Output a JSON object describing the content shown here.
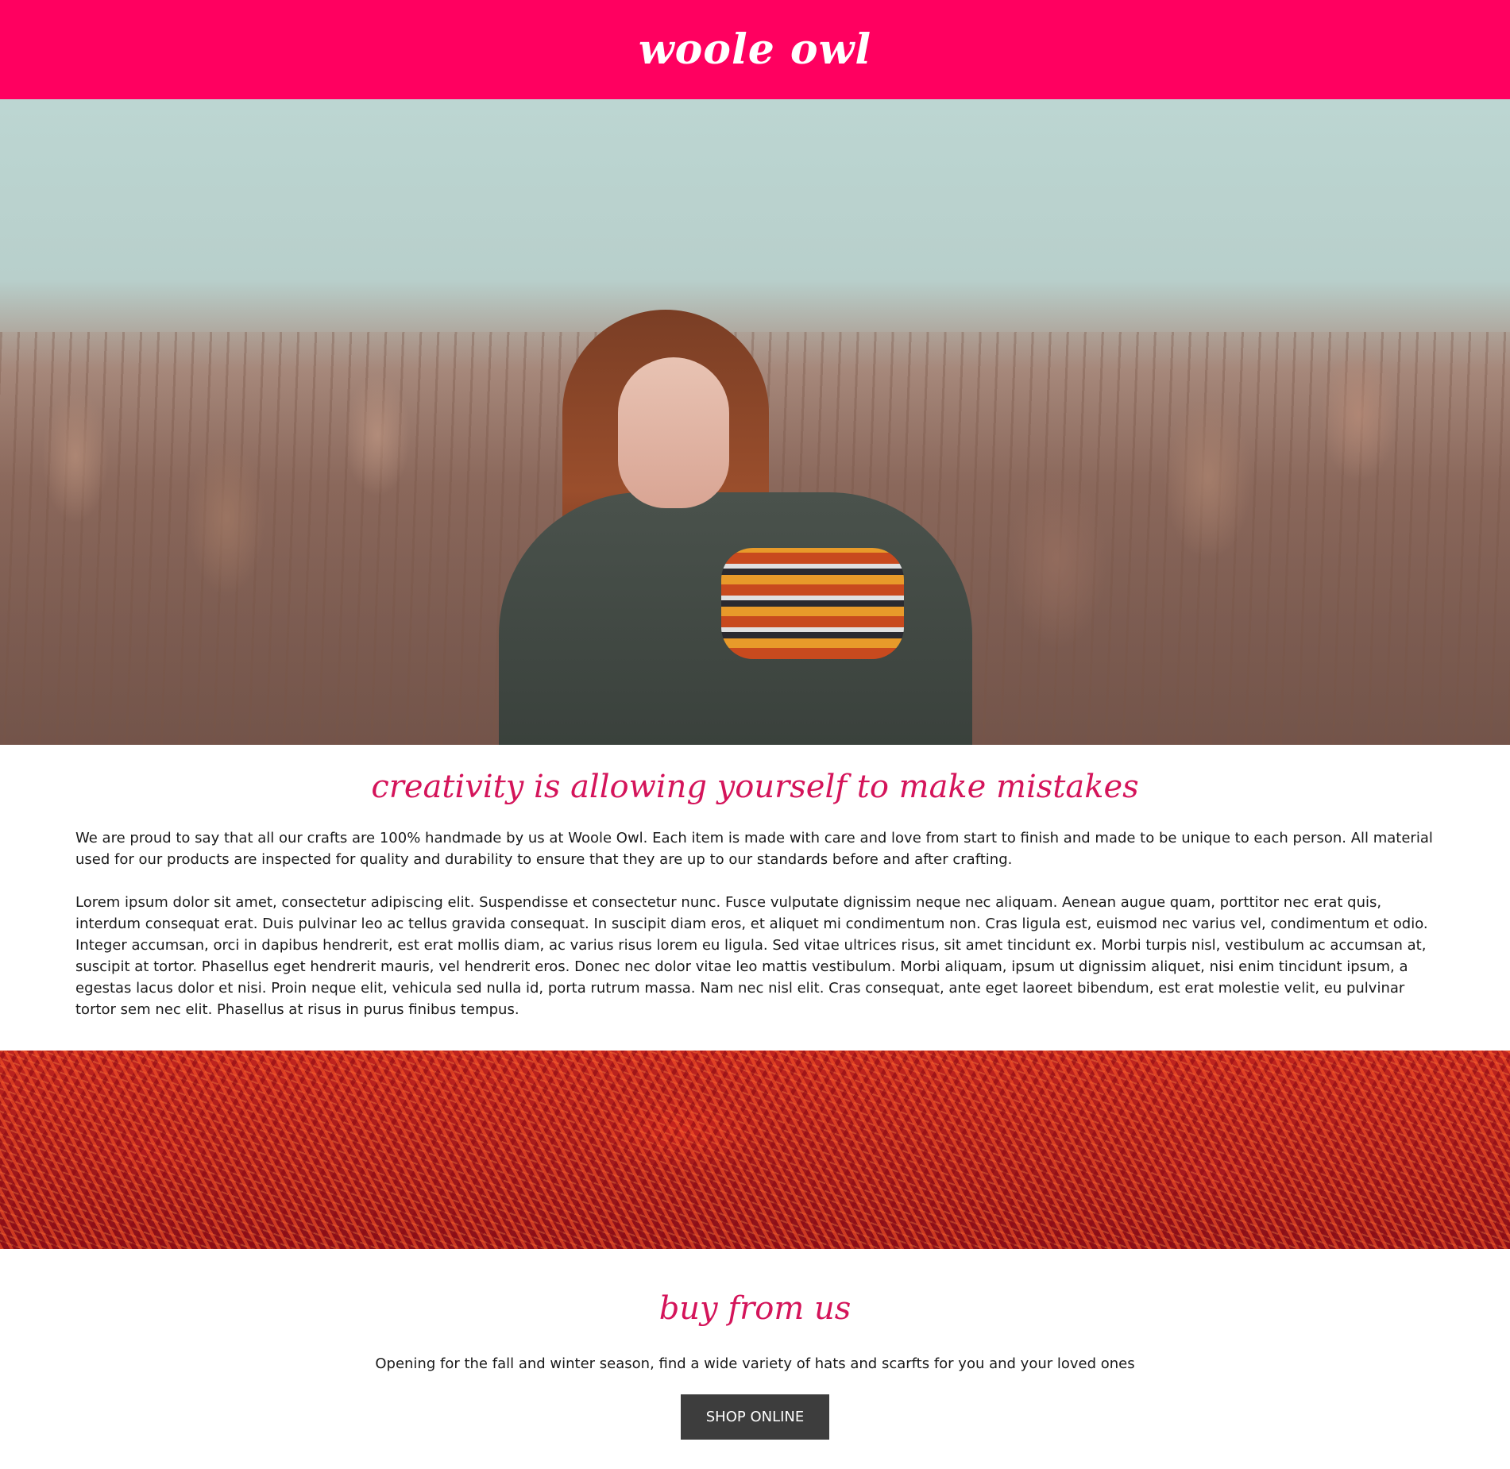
{
  "header": {
    "brand": "woole owl",
    "background_color": "#ff0060"
  },
  "hero": {
    "image": "woman-in-field-photo"
  },
  "about": {
    "heading": "creativity is allowing yourself to make mistakes",
    "paragraphs": [
      "We are proud to say that all our crafts are 100% handmade by us at Woole Owl. Each item is made with care and love from start to finish and made to be unique to each person. All material used for our products are inspected for quality and durability to ensure that they are up to our standards before and after crafting.",
      "Lorem ipsum dolor sit amet, consectetur adipiscing elit. Suspendisse et consectetur nunc. Fusce vulputate dignissim neque nec aliquam. Aenean augue quam, porttitor nec erat quis, interdum consequat erat. Duis pulvinar leo ac tellus gravida consequat. In suscipit diam eros, et aliquet mi condimentum non. Cras ligula est, euismod nec varius vel, condimentum et odio. Integer accumsan, orci in dapibus hendrerit, est erat mollis diam, ac varius risus lorem eu ligula. Sed vitae ultrices risus, sit amet tincidunt ex. Morbi turpis nisl, vestibulum ac accumsan at, suscipit at tortor. Phasellus eget hendrerit mauris, vel hendrerit eros. Donec nec dolor vitae leo mattis vestibulum. Morbi aliquam, ipsum ut dignissim aliquet, nisi enim tincidunt ipsum, a egestas lacus dolor et nisi. Proin neque elit, vehicula sed nulla id, porta rutrum massa. Nam nec nisl elit. Cras consequat, ante eget laoreet bibendum, est erat molestie velit, eu pulvinar tortor sem nec elit. Phasellus at risus in purus finibus tempus."
    ],
    "heading_color": "#d4145a"
  },
  "yarn_banner": {
    "image": "red-yarn-texture-photo"
  },
  "shop": {
    "heading": "buy from us",
    "text": "Opening for the fall and winter season, find a wide variety of hats and scarfts for you and your loved ones",
    "button_label": "SHOP ONLINE",
    "button_color": "#3d3d3d"
  }
}
